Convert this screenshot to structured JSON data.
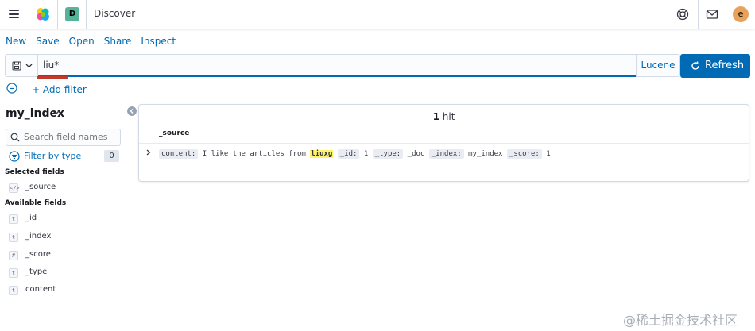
{
  "header": {
    "space_initial": "D",
    "title": "Discover",
    "avatar_initial": "e",
    "icons": [
      "menu-icon",
      "elastic-logo",
      "help-icon",
      "mail-icon"
    ]
  },
  "nav": {
    "new": "New",
    "save": "Save",
    "open": "Open",
    "share": "Share",
    "inspect": "Inspect"
  },
  "query": {
    "value": "liu*",
    "language": "Lucene",
    "refresh": "Refresh"
  },
  "filter": {
    "add": "+ Add filter"
  },
  "sidebar": {
    "index": "my_index",
    "search_placeholder": "Search field names",
    "filter_by_type": "Filter by type",
    "filter_count": "0",
    "selected_heading": "Selected fields",
    "available_heading": "Available fields",
    "selected": [
      {
        "type": "</>",
        "name": "_source"
      }
    ],
    "available": [
      {
        "type": "t",
        "name": "_id"
      },
      {
        "type": "t",
        "name": "_index"
      },
      {
        "type": "#",
        "name": "_score"
      },
      {
        "type": "t",
        "name": "_type"
      },
      {
        "type": "t",
        "name": "content"
      }
    ]
  },
  "results": {
    "hit_count": "1",
    "hit_label": " hit",
    "column": "_source",
    "doc": {
      "k_content": "content:",
      "v_content_pre": "I like the articles from",
      "v_content_hl": "liuxg",
      "k_id": "_id:",
      "v_id": "1",
      "k_type": "_type:",
      "v_type": "_doc",
      "k_index": "_index:",
      "v_index": "my_index",
      "k_score": "_score:",
      "v_score": "1"
    }
  },
  "watermark": "@稀土掘金技术社区",
  "colors": {
    "primary": "#006bb4",
    "space_badge": "#54b399",
    "avatar": "#e7a35c",
    "highlight": "#fff36a"
  }
}
